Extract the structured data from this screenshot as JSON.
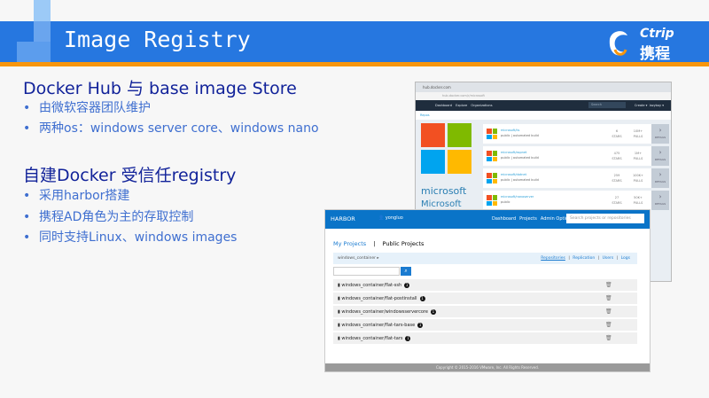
{
  "slide": {
    "title": "Image Registry",
    "logo_en": "Ctrip",
    "logo_cn": "携程"
  },
  "sections": [
    {
      "heading": "Docker Hub 与 base image Store",
      "bullets": [
        "由微软容器团队维护",
        "两种os：windows server core、windows nano"
      ]
    },
    {
      "heading": "自建Docker 受信任registry",
      "bullets": [
        "采用harbor搭建",
        "携程AD角色为主的存取控制",
        "同时支持Linux、windows images"
      ]
    }
  ],
  "docker_hub": {
    "tab": "hub.docker.com",
    "address": "hub.docker.com/r/microsoft",
    "nav": [
      "Dashboard",
      "Explore",
      "Organizations"
    ],
    "search_placeholder": "Search",
    "create": "Create ▾",
    "user": "lazyboy ▾",
    "breadcrumb": "Repos",
    "org_name": "microsoft",
    "org_display": "Microsoft",
    "ms_colors": [
      "#f25022",
      "#7fba00",
      "#00a4ef",
      "#ffb900"
    ],
    "repos": [
      {
        "name": "microsoft/iis",
        "desc": "public | automated build",
        "stars": "6",
        "pulls": "10M+"
      },
      {
        "name": "microsoft/aspnet",
        "desc": "public | automated build",
        "stars": "475",
        "pulls": "1M+"
      },
      {
        "name": "microsoft/dotnet",
        "desc": "public | automated build",
        "stars": "259",
        "pulls": "100K+"
      },
      {
        "name": "microsoft/nanoserver",
        "desc": "public",
        "stars": "27",
        "pulls": "50K+"
      }
    ],
    "stars_label": "STARS",
    "pulls_label": "PULLS",
    "details_label": "DETAILS"
  },
  "harbor": {
    "brand": "HARBOR",
    "user": "yongluo",
    "nav": [
      "Dashboard",
      "Projects",
      "Admin Options"
    ],
    "search_placeholder": "Search projects or repositories",
    "tabs": [
      "My Projects",
      "|",
      "Public Projects"
    ],
    "project": "windows_container ▸",
    "subtabs": [
      "Repositories",
      "|",
      "Replication",
      "|",
      "Users",
      "|",
      "Logs"
    ],
    "repos": [
      {
        "name": "windows_container/flat-ssh",
        "count": "1"
      },
      {
        "name": "windows_container/flat-postinstall",
        "count": "1"
      },
      {
        "name": "windows_container/windowsservercore",
        "count": "1"
      },
      {
        "name": "windows_container/flat-tars-base",
        "count": "1"
      },
      {
        "name": "windows_container/flat-tars",
        "count": "1"
      }
    ],
    "footer": "Copyright © 2015-2016 VMware, Inc. All Rights Reserved."
  }
}
